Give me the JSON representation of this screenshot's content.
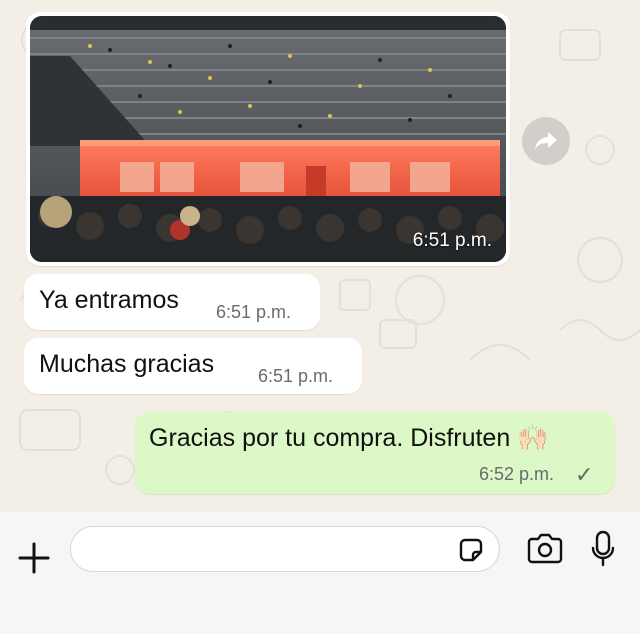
{
  "colors": {
    "incoming_bubble": "#ffffff",
    "outgoing_bubble": "#dcf8c6",
    "chat_background": "#f3efe7",
    "composer_background": "#f6f6f6",
    "time_text": "#6b6b6b"
  },
  "messages": [
    {
      "type": "image",
      "direction": "incoming",
      "time": "6:51 p.m."
    },
    {
      "type": "text",
      "direction": "incoming",
      "text": "Ya entramos",
      "time": "6:51 p.m."
    },
    {
      "type": "text",
      "direction": "incoming",
      "text": "Muchas gracias",
      "time": "6:51 p.m."
    },
    {
      "type": "text",
      "direction": "outgoing",
      "text": "Gracias por tu compra. Disfruten 🙌🏻",
      "time": "6:52 p.m.",
      "status": "✓"
    }
  ],
  "composer": {
    "input_value": "",
    "icons": [
      "plus-icon",
      "sticker-icon",
      "camera-icon",
      "microphone-icon"
    ]
  },
  "icons": {
    "forward": "forward-arrow-icon"
  }
}
